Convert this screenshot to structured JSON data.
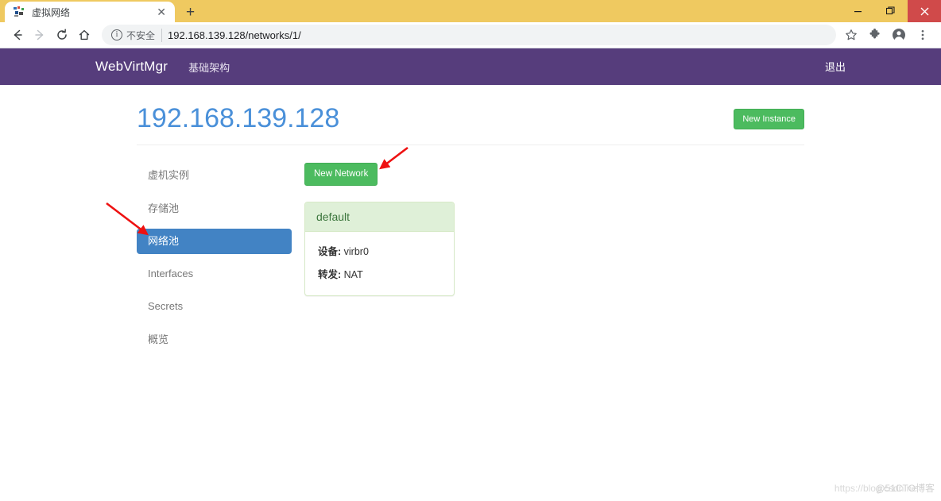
{
  "browser": {
    "tab": {
      "title": "虚拟网络",
      "favicon_icon": "app-favicon",
      "close_icon": "✕"
    },
    "new_tab_label": "+",
    "window_controls": {
      "minimize": "—",
      "maximize": "❐",
      "close": "✕"
    },
    "nav": {
      "back_icon": "←",
      "forward_icon": "→",
      "reload_icon": "⟳",
      "home_icon": "⌂"
    },
    "omnibox": {
      "info_icon": "i",
      "security_label": "不安全",
      "url": "192.168.139.128/networks/1/"
    },
    "toolbar_icons": {
      "bookmark": "☆",
      "extensions": "puzzle-icon",
      "profile": "profile-icon",
      "menu": "⋮"
    }
  },
  "navbar": {
    "brand": "WebVirtMgr",
    "links": [
      {
        "label": "基础架构"
      }
    ],
    "logout_label": "退出",
    "bg_color": "#563d7c"
  },
  "header": {
    "title": "192.168.139.128",
    "new_instance_label": "New Instance",
    "title_color": "#4a90d9"
  },
  "sidebar": {
    "items": [
      {
        "label": "虚机实例",
        "active": false
      },
      {
        "label": "存储池",
        "active": false
      },
      {
        "label": "网络池",
        "active": true
      },
      {
        "label": "Interfaces",
        "active": false
      },
      {
        "label": "Secrets",
        "active": false
      },
      {
        "label": "概览",
        "active": false
      }
    ],
    "active_color": "#4283c4"
  },
  "content": {
    "new_network_label": "New Network",
    "networks": [
      {
        "name": "default",
        "rows": [
          {
            "label": "设备:",
            "value": "virbr0"
          },
          {
            "label": "转发:",
            "value": "NAT"
          }
        ]
      }
    ],
    "panel_header_bg": "#dff0d8",
    "panel_header_color": "#3c763d"
  },
  "watermark": {
    "text1": "https://blog.csdn.ne",
    "text2": "@51CTO博客"
  }
}
